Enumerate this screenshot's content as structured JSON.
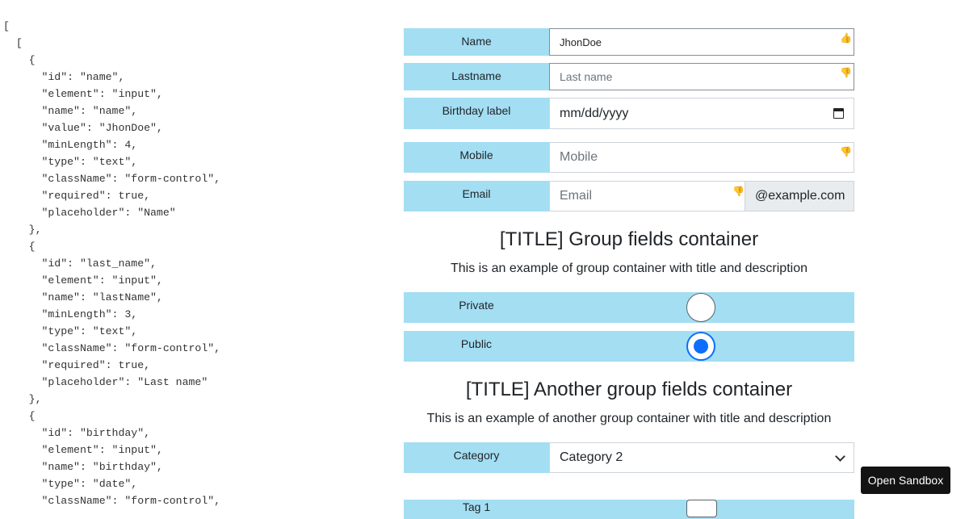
{
  "code_text": "[\n  [\n    {\n      \"id\": \"name\",\n      \"element\": \"input\",\n      \"name\": \"name\",\n      \"value\": \"JhonDoe\",\n      \"minLength\": 4,\n      \"type\": \"text\",\n      \"className\": \"form-control\",\n      \"required\": true,\n      \"placeholder\": \"Name\"\n    },\n    {\n      \"id\": \"last_name\",\n      \"element\": \"input\",\n      \"name\": \"lastName\",\n      \"minLength\": 3,\n      \"type\": \"text\",\n      \"className\": \"form-control\",\n      \"required\": true,\n      \"placeholder\": \"Last name\"\n    },\n    {\n      \"id\": \"birthday\",\n      \"element\": \"input\",\n      \"name\": \"birthday\",\n      \"type\": \"date\",\n      \"className\": \"form-control\",",
  "form": {
    "name": {
      "label": "Name",
      "value": "JhonDoe"
    },
    "lastname": {
      "label": "Lastname",
      "placeholder": "Last name"
    },
    "birthday": {
      "label": "Birthday label",
      "placeholder": "mm/dd/yyyy"
    },
    "mobile": {
      "label": "Mobile",
      "placeholder": "Mobile"
    },
    "email": {
      "label": "Email",
      "placeholder": "Email",
      "addon": "@example.com"
    },
    "group1": {
      "title": "[TITLE] Group fields container",
      "description": "This is an example of group container with title and description",
      "radios": [
        {
          "label": "Private",
          "checked": false
        },
        {
          "label": "Public",
          "checked": true
        }
      ]
    },
    "group2": {
      "title": "[TITLE] Another group fields container",
      "description": "This is an example of another group container with title and description",
      "category": {
        "label": "Category",
        "selected": "Category 2"
      },
      "tag1": {
        "label": "Tag 1"
      }
    }
  },
  "sandbox_button": "Open Sandbox",
  "colors": {
    "row_bg": "#a3def2",
    "radio_checked": "#0d6efd",
    "valid_icon": "#6bb56b",
    "invalid_icon": "#f0a38e"
  }
}
